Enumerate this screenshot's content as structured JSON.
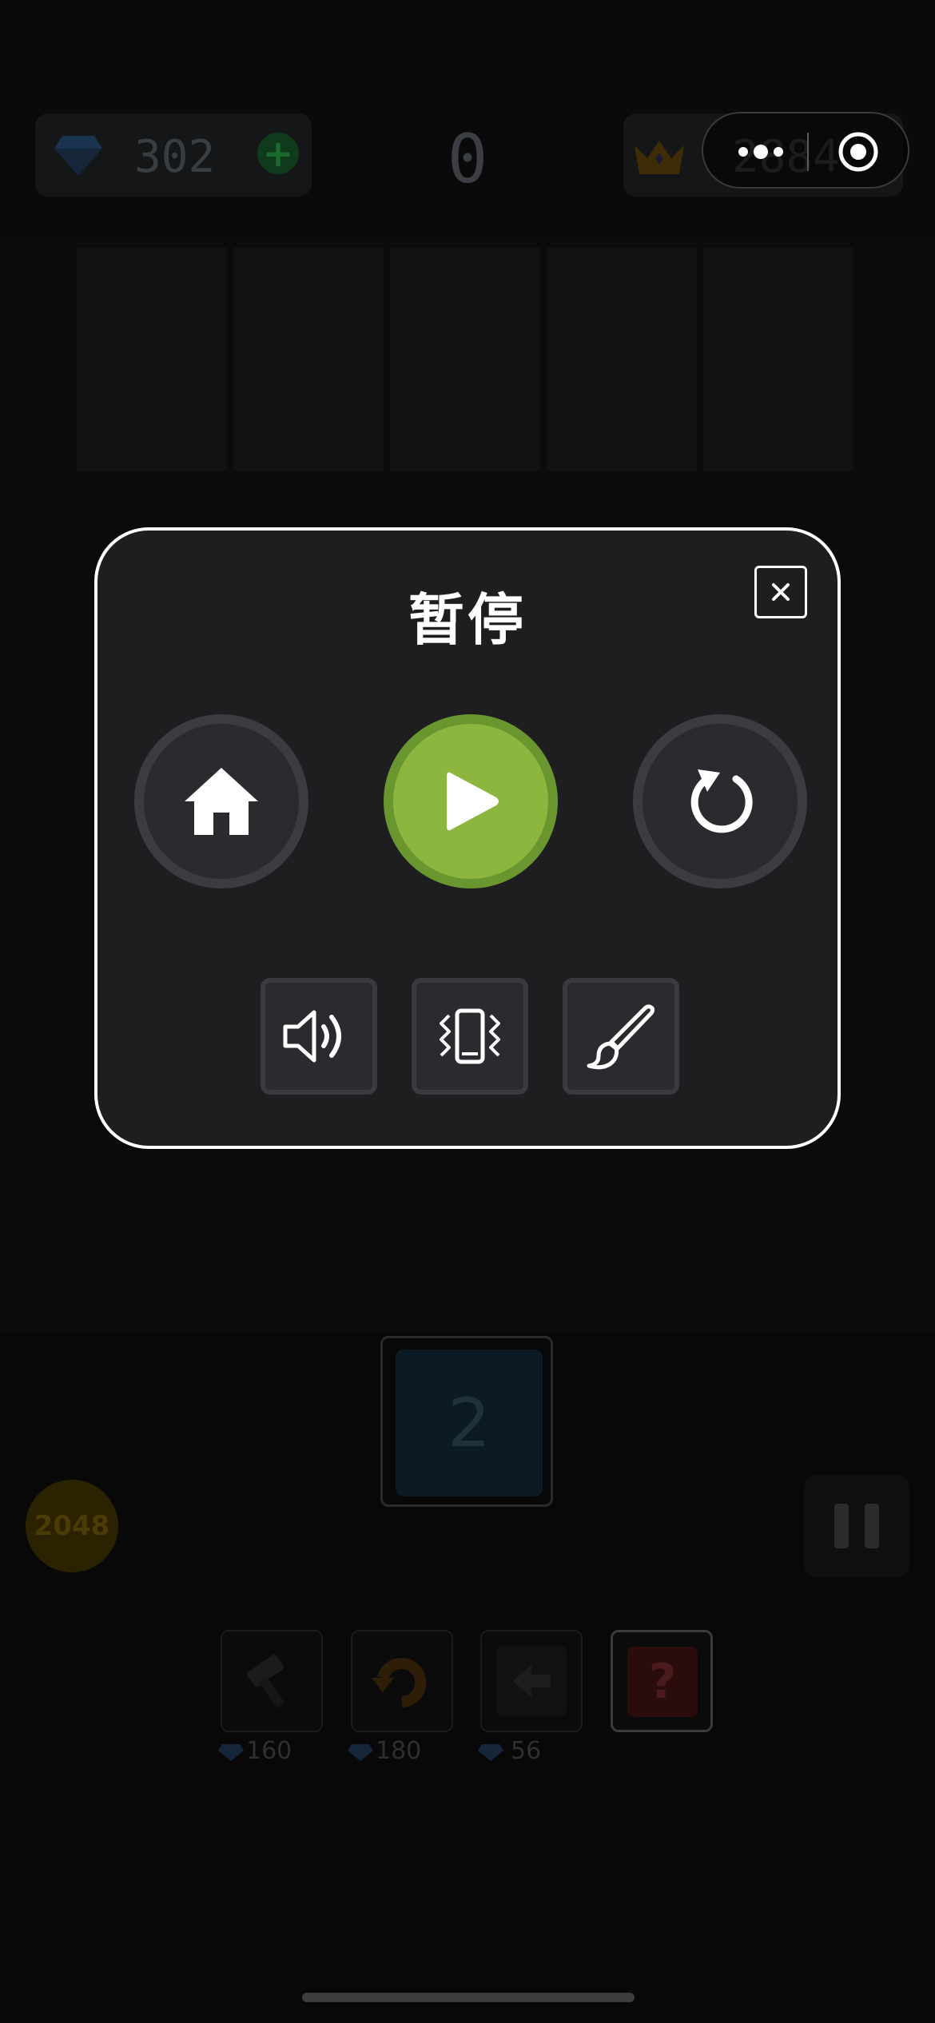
{
  "hud": {
    "gems": "302",
    "gem_plus": "+",
    "score": "0",
    "best": "2884"
  },
  "next_tile": {
    "value": "2"
  },
  "coin_label": "2048",
  "tools": [
    {
      "icon": "hammer-icon",
      "cost": "160"
    },
    {
      "icon": "undo-icon",
      "cost": "180"
    },
    {
      "icon": "swap-icon",
      "cost": "56"
    },
    {
      "icon": "question-icon",
      "cost": ""
    }
  ],
  "tool_question_mark": "?",
  "dialog": {
    "title": "暂停",
    "buttons": {
      "home": "home-icon",
      "resume": "play-icon",
      "restart": "restart-icon",
      "sound": "speaker-icon",
      "vibration": "vibration-icon",
      "theme": "brush-icon"
    }
  },
  "colors": {
    "dialog_bg": "#1e1e20",
    "dialog_border": "#ffffff",
    "play_green": "#8cb63d",
    "button_ring": "#3b3c42"
  }
}
